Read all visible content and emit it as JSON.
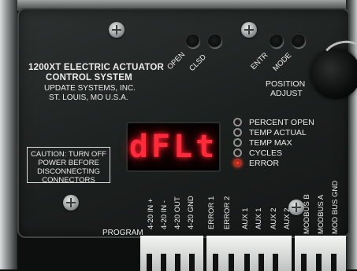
{
  "panel": {
    "title_line1": "1200XT ELECTRIC ACTUATOR",
    "title_line2": "CONTROL SYSTEM",
    "maker_line1": "UPDATE SYSTEMS, INC.",
    "maker_line2": "ST. LOUIS, MO  U.S.A."
  },
  "buttons": {
    "open": "OPEN",
    "clsd": "CLSD",
    "entr": "ENTR",
    "mode": "MODE"
  },
  "knob": {
    "label_line1": "POSITION",
    "label_line2": "ADJUST"
  },
  "display": {
    "text": "dFLt",
    "color": "#ff2a3a"
  },
  "indicators": [
    {
      "label": "PERCENT OPEN",
      "on": false
    },
    {
      "label": "TEMP ACTUAL",
      "on": false
    },
    {
      "label": "TEMP MAX",
      "on": false
    },
    {
      "label": "CYCLES",
      "on": false
    },
    {
      "label": "ERROR",
      "on": true
    }
  ],
  "caution": {
    "line1": "CAUTION: TURN OFF",
    "line2": "POWER BEFORE",
    "line3": "DISCONNECTING",
    "line4": "CONNECTORS"
  },
  "terminals": {
    "program_label": "PROGRAM",
    "labels": [
      "4-20 IN +",
      "4-20 IN -",
      "4-20 OUT",
      "4-20 GND",
      "ERROR 1",
      "ERROR 2",
      "AUX 1",
      "AUX 1",
      "AUX 2",
      "AUX 2",
      "MODBUS B",
      "MODBUS A",
      "MOD BUS GND"
    ]
  }
}
